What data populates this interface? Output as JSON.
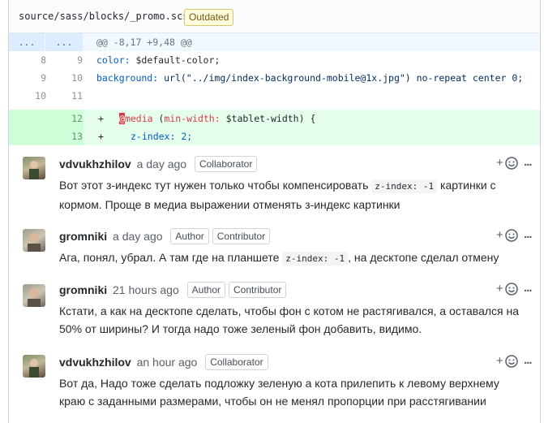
{
  "file": {
    "path": "source/sass/blocks/_promo.scss",
    "status": "Outdated"
  },
  "diff": {
    "hunk": {
      "left": "...",
      "right": "...",
      "header": "@@ -8,17 +9,48 @@"
    },
    "lines": [
      {
        "old": "8",
        "new": "9",
        "prop": "color:",
        "rest": " $default-color;"
      },
      {
        "old": "9",
        "new": "10",
        "prop": "background:",
        "rest": " url(\"../img/index-background-mobile@1x.jpg\") no-repeat center 0;"
      },
      {
        "old": "10",
        "new": "11",
        "prop": "",
        "rest": ""
      }
    ],
    "added": [
      {
        "new": "12",
        "sign": "+",
        "cursor": "@",
        "kw": "media",
        "paren": " (",
        "prop": "min-width:",
        "rest": " $tablet-width) {"
      },
      {
        "new": "13",
        "sign": "+",
        "prop": "z-index:",
        "rest": " 2;"
      }
    ]
  },
  "comments": [
    {
      "author": "vdvukhzhilov",
      "time": "a day ago",
      "badges": [
        "Collaborator"
      ],
      "body_pre": "Вот этот з-индекс тут нужен только чтобы компенсировать ",
      "code": "z-index: -1",
      "body_post": " картинки с кормом. Проще в медиа выражении отменять з-индекс картинки"
    },
    {
      "author": "gromniki",
      "time": "a day ago",
      "badges": [
        "Author",
        "Contributor"
      ],
      "body_pre": "Ага, понял, убрал. А там где на планшете ",
      "code": "z-index: -1",
      "body_post": ", на десктопе сделал отмену"
    },
    {
      "author": "gromniki",
      "time": "21 hours ago",
      "badges": [
        "Author",
        "Contributor"
      ],
      "body": "Кстати, а как на десктопе сделать, чтобы фон с котом не растягивался, а оставался на 50% от ширины? И тогда надо тоже зеленый фон добавить, видимо."
    },
    {
      "author": "vdvukhzhilov",
      "time": "an hour ago",
      "badges": [
        "Collaborator"
      ],
      "body": "Вот да, Надо тоже сделать подложку зеленую а кота прилепить к левому верхнему краю с заданными размерами, чтобы он не менял пропорции при расстягивании"
    }
  ],
  "reaction": {
    "plus": "+",
    "icon": "smiley-icon",
    "more": "..."
  }
}
